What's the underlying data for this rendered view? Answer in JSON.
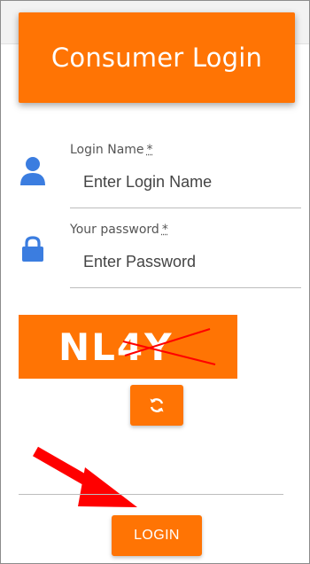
{
  "title": "Consumer Login",
  "fields": [
    {
      "label": "Login Name",
      "required_mark": "*",
      "placeholder": "Enter Login Name",
      "icon": "user-icon"
    },
    {
      "label": "Your password",
      "required_mark": "*",
      "placeholder": "Enter Password",
      "icon": "lock-icon"
    }
  ],
  "captcha": {
    "text": "NL4Y",
    "refresh_icon": "refresh-icon"
  },
  "login_button": "LOGIN",
  "colors": {
    "accent": "#ff7404",
    "icon": "#3b7de0",
    "arrow": "#ff0000"
  }
}
